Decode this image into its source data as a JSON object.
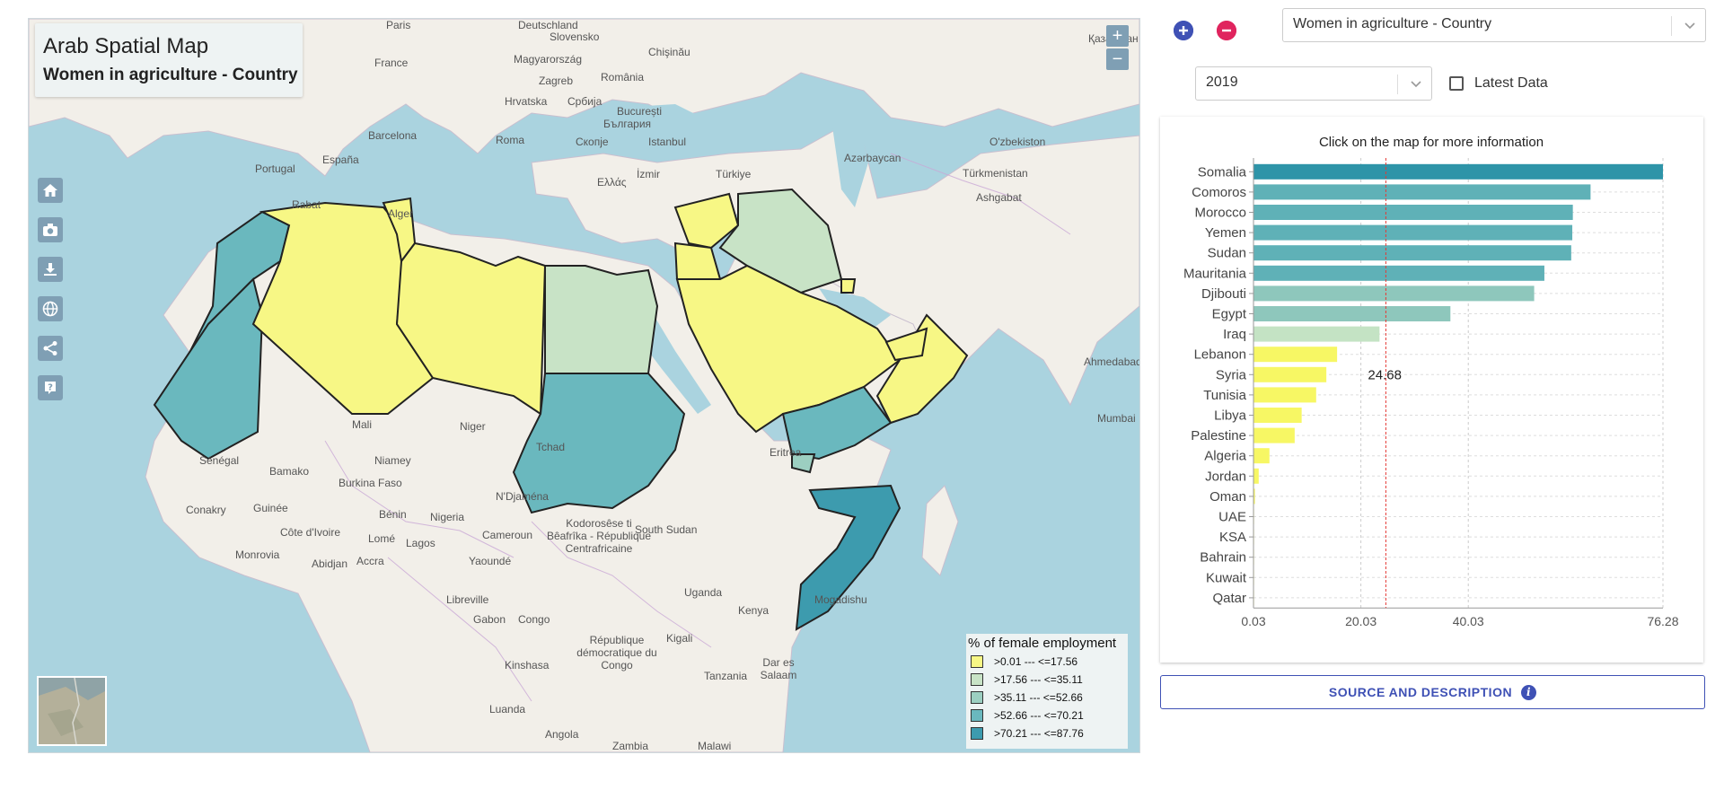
{
  "map": {
    "title": "Arab Spatial Map",
    "subtitle": "Women in agriculture - Country",
    "zoom_in": "+",
    "zoom_out": "−",
    "tools": [
      "home-icon",
      "camera-icon",
      "download-icon",
      "globe-icon",
      "share-icon",
      "help-icon"
    ],
    "labels": [
      {
        "text": "Paris",
        "cls": "c"
      },
      {
        "text": "Deutschland",
        "cls": "c"
      },
      {
        "text": "Slovensko",
        "cls": "c"
      },
      {
        "text": "Chişinău",
        "cls": "c"
      },
      {
        "text": "Magyarország",
        "cls": "c"
      },
      {
        "text": "France",
        "cls": "c"
      },
      {
        "text": "România",
        "cls": "c"
      },
      {
        "text": "Zagreb",
        "cls": "c"
      },
      {
        "text": "Hrvatska",
        "cls": "c"
      },
      {
        "text": "Србија",
        "cls": "c"
      },
      {
        "text": "București",
        "cls": "c"
      },
      {
        "text": "България",
        "cls": "c"
      },
      {
        "text": "Barcelona",
        "cls": "c"
      },
      {
        "text": "Roma",
        "cls": "c"
      },
      {
        "text": "Istanbul",
        "cls": "c"
      },
      {
        "text": "Скопје",
        "cls": "c"
      },
      {
        "text": "España",
        "cls": "c"
      },
      {
        "text": "Portugal",
        "cls": "c"
      },
      {
        "text": "İzmir",
        "cls": "c"
      },
      {
        "text": "Türkiye",
        "cls": "c"
      },
      {
        "text": "Ελλάς",
        "cls": "c"
      },
      {
        "text": "Қазақстан",
        "cls": "c"
      },
      {
        "text": "Azərbaycan",
        "cls": "c"
      },
      {
        "text": "Türkmenistan",
        "cls": "c"
      },
      {
        "text": "O'zbekiston",
        "cls": "c"
      },
      {
        "text": "Ashgabat",
        "cls": "c"
      },
      {
        "text": "Rabat",
        "cls": "c"
      },
      {
        "text": "Alger",
        "cls": "c"
      },
      {
        "text": "Mali",
        "cls": "c"
      },
      {
        "text": "Niger",
        "cls": "c"
      },
      {
        "text": "Tchad",
        "cls": "c"
      },
      {
        "text": "Sénégal",
        "cls": "c"
      },
      {
        "text": "Bamako",
        "cls": "c"
      },
      {
        "text": "Niamey",
        "cls": "c"
      },
      {
        "text": "Burkina Faso",
        "cls": "c"
      },
      {
        "text": "N'Djaména",
        "cls": "c"
      },
      {
        "text": "Bénin",
        "cls": "c"
      },
      {
        "text": "Nigeria",
        "cls": "c"
      },
      {
        "text": "Guinée",
        "cls": "c"
      },
      {
        "text": "Conakry",
        "cls": "c"
      },
      {
        "text": "Côte d'Ivoire",
        "cls": "c"
      },
      {
        "text": "Lomé",
        "cls": "c"
      },
      {
        "text": "Lagos",
        "cls": "c"
      },
      {
        "text": "Monrovia",
        "cls": "c"
      },
      {
        "text": "Abidjan",
        "cls": "c"
      },
      {
        "text": "Accra",
        "cls": "c"
      },
      {
        "text": "Yaoundé",
        "cls": "c"
      },
      {
        "text": "Cameroun",
        "cls": "c"
      },
      {
        "text": "South Sudan",
        "cls": "c"
      },
      {
        "text": "Eritrea",
        "cls": "c"
      },
      {
        "text": "Kenya",
        "cls": "c"
      },
      {
        "text": "Uganda",
        "cls": "c"
      },
      {
        "text": "Libreville",
        "cls": "c"
      },
      {
        "text": "Gabon",
        "cls": "c"
      },
      {
        "text": "Congo",
        "cls": "c"
      },
      {
        "text": "Kigali",
        "cls": "c"
      },
      {
        "text": "Kinshasa",
        "cls": "c"
      },
      {
        "text": "République démocratique du Congo",
        "cls": "c"
      },
      {
        "text": "Dar es Salaam",
        "cls": "c"
      },
      {
        "text": "Tanzania",
        "cls": "c"
      },
      {
        "text": "Luanda",
        "cls": "c"
      },
      {
        "text": "Angola",
        "cls": "c"
      },
      {
        "text": "Zambia",
        "cls": "c"
      },
      {
        "text": "Malawi",
        "cls": "c"
      },
      {
        "text": "Mogadishu",
        "cls": "c"
      },
      {
        "text": "Ahmedabad",
        "cls": "c"
      },
      {
        "text": "Mumbai",
        "cls": "c"
      },
      {
        "text": "Kodorosêse ti Bêafrîka - République Centrafricaine",
        "cls": "c"
      }
    ]
  },
  "legend": {
    "title": "% of female employment",
    "items": [
      {
        "label": ">0.01  ---  <=17.56",
        "color": "#f7f785"
      },
      {
        "label": ">17.56  ---  <=35.11",
        "color": "#c8e3c6"
      },
      {
        "label": ">35.11  ---  <=52.66",
        "color": "#9ccfc1"
      },
      {
        "label": ">52.66  ---  <=70.21",
        "color": "#6ab8be"
      },
      {
        "label": ">70.21  ---  <=87.76",
        "color": "#3d9bae"
      }
    ]
  },
  "controls": {
    "indicator_select": "Women in agriculture - Country",
    "year_select": "2019",
    "latest_label": "Latest Data",
    "latest_checked": false
  },
  "chart_data": {
    "type": "bar",
    "orientation": "horizontal",
    "title": "Click on the map for more information",
    "categories": [
      "Somalia",
      "Comoros",
      "Morocco",
      "Yemen",
      "Sudan",
      "Mauritania",
      "Djibouti",
      "Egypt",
      "Iraq",
      "Lebanon",
      "Syria",
      "Tunisia",
      "Libya",
      "Palestine",
      "Algeria",
      "Jordan",
      "Oman",
      "UAE",
      "KSA",
      "Bahrain",
      "Kuwait",
      "Qatar"
    ],
    "values": [
      76.28,
      62.8,
      59.5,
      59.4,
      59.2,
      54.2,
      52.3,
      36.7,
      23.5,
      15.6,
      13.6,
      11.7,
      9.0,
      7.7,
      3.0,
      1.0,
      0.3,
      0.1,
      0.1,
      0.05,
      0.04,
      0.03
    ],
    "colors": [
      "#2e94a8",
      "#5fb1b7",
      "#5fb1b7",
      "#5fb1b7",
      "#5fb1b7",
      "#5fb1b7",
      "#8ec7bc",
      "#8ec7bc",
      "#c4e3c4",
      "#f7f764",
      "#f7f764",
      "#f7f764",
      "#f7f764",
      "#f7f764",
      "#f7f764",
      "#f7f764",
      "#f7f764",
      "#f7f764",
      "#f7f764",
      "#f7f764",
      "#f7f764",
      "#f7f764"
    ],
    "xticks": [
      "0.03",
      "20.03",
      "40.03",
      "76.28"
    ],
    "xlim": [
      0.03,
      76.28
    ],
    "reference_line": {
      "value": 24.68,
      "label": "24.68"
    },
    "grid": true
  },
  "source_button": "SOURCE AND DESCRIPTION",
  "info_icon": "i"
}
